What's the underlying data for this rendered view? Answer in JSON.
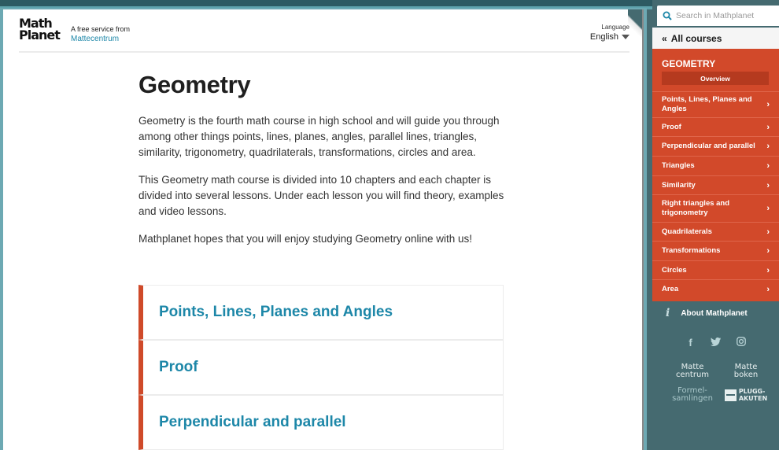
{
  "header": {
    "logo_text": "Math Planet",
    "tagline": "A free service from",
    "tagline_link": "Mattecentrum",
    "language_label": "Language",
    "language_value": "English"
  },
  "content": {
    "title": "Geometry",
    "paragraphs": [
      "Geometry is the fourth math course in high school and will guide you through among other things points, lines, planes, angles, parallel lines, triangles, similarity, trigonometry, quadrilaterals, transformations, circles and area.",
      "This Geometry math course is divided into 10 chapters and each chapter is divided into several lessons. Under each lesson you will find theory, examples and video lessons.",
      "Mathplanet hopes that you will enjoy studying Geometry online with us!"
    ],
    "chapters": [
      "Points, Lines, Planes and Angles",
      "Proof",
      "Perpendicular and parallel"
    ]
  },
  "sidebar": {
    "search_placeholder": "Search in Mathplanet",
    "all_courses": "All courses",
    "course_title": "GEOMETRY",
    "overview": "Overview",
    "nav_items": [
      "Points, Lines, Planes and Angles",
      "Proof",
      "Perpendicular and parallel",
      "Triangles",
      "Similarity",
      "Right triangles and trigonometry",
      "Quadrilaterals",
      "Transformations",
      "Circles",
      "Area"
    ],
    "about": "About Mathplanet",
    "social": [
      "facebook",
      "twitter",
      "instagram"
    ],
    "brands": {
      "mattecentrum": "Matte centrum",
      "matteboken": "Matte boken",
      "formelsamlingen": "Formel- samlingen",
      "pluggakuten_1": "PLUGG-",
      "pluggakuten_2": "AKUTEN"
    },
    "colors": {
      "accent": "#d2492a",
      "link": "#1d87a8",
      "sidebar_bg": "#456a70"
    }
  }
}
